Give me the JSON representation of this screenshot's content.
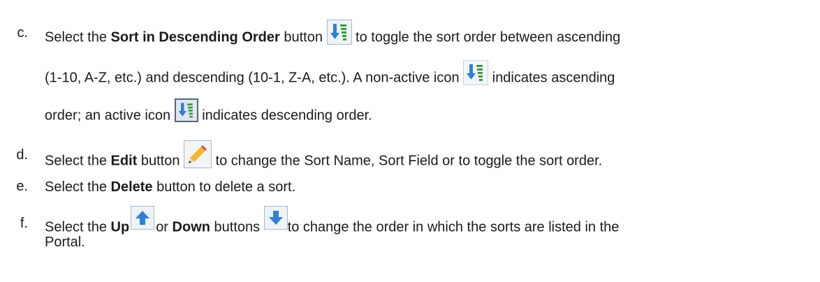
{
  "items": [
    {
      "marker": "c.",
      "line1": {
        "pre": "Select the ",
        "bold": "Sort in Descending Order",
        "mid": " button ",
        "post": " to toggle the sort order between ascending"
      },
      "line2": {
        "pre": "(1-10, A-Z, etc.) and descending (10-1, Z-A, etc.). A non-active icon ",
        "post": " indicates ascending"
      },
      "line3": {
        "pre": "order; an active icon ",
        "post": " indicates descending order."
      }
    },
    {
      "marker": "d.",
      "pre": "Select the ",
      "bold": "Edit",
      "mid": " button ",
      "post": " to change the Sort Name, Sort Field or to toggle the sort order."
    },
    {
      "marker": "e.",
      "pre": "Select the ",
      "bold": "Delete",
      "post": " button to delete a sort."
    },
    {
      "marker": "f.",
      "pre": "Select the ",
      "bold_up": "Up",
      "or": "or ",
      "bold_down": "Down",
      "mid": " buttons ",
      "post": "to change the order in which the sorts are listed in the",
      "line2": "Portal."
    }
  ],
  "icons": {
    "sort": "sort-descending-icon",
    "edit": "pencil-icon",
    "up": "arrow-up-icon",
    "down": "arrow-down-icon"
  },
  "colors": {
    "text": "#1a1a1a",
    "arrow_blue": "#2f7fd8",
    "bars_green": "#3a9a3a",
    "icon_bg": "#eef3f8",
    "icon_border": "#a9b8c8",
    "active_border": "#556677"
  }
}
